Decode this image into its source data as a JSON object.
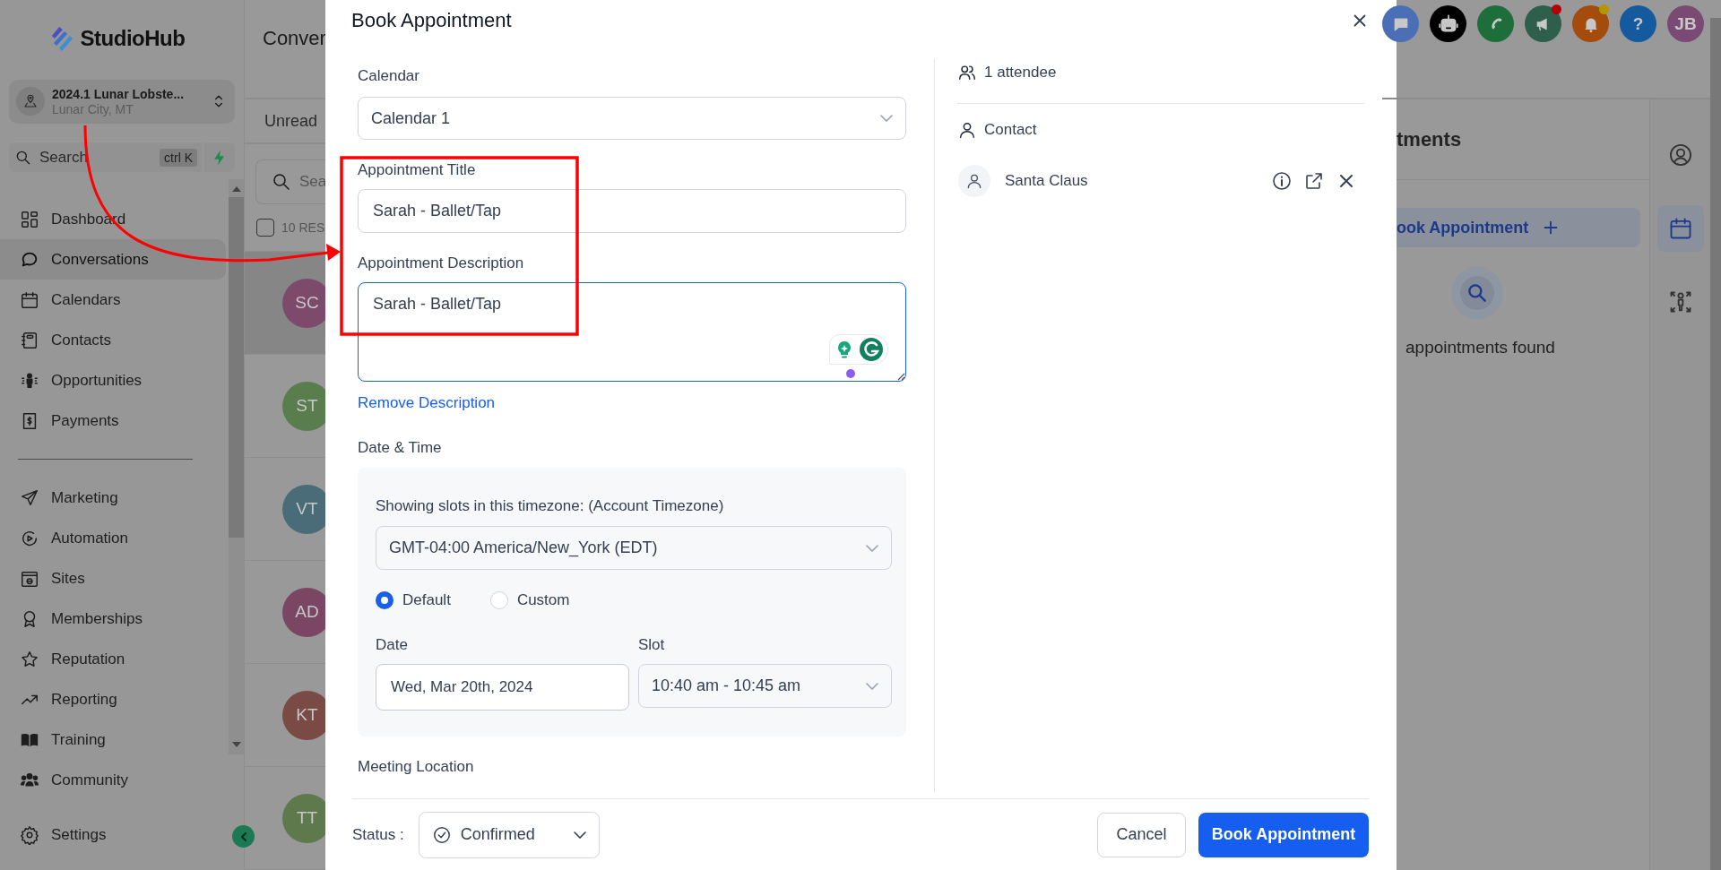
{
  "sidebar": {
    "logo": "StudioHub",
    "location": {
      "name": "2024.1 Lunar Lobste...",
      "city": "Lunar City, MT"
    },
    "search": {
      "placeholder": "Search",
      "shortcut": "ctrl K"
    },
    "nav": [
      {
        "label": "Dashboard",
        "selected": false
      },
      {
        "label": "Conversations",
        "selected": true
      },
      {
        "label": "Calendars",
        "selected": false
      },
      {
        "label": "Contacts",
        "selected": false
      },
      {
        "label": "Opportunities",
        "selected": false
      },
      {
        "label": "Payments",
        "selected": false
      }
    ],
    "nav_secondary": [
      {
        "label": "Marketing",
        "selected": false
      },
      {
        "label": "Automation",
        "selected": false
      },
      {
        "label": "Sites",
        "selected": false
      },
      {
        "label": "Memberships",
        "selected": false
      },
      {
        "label": "Reputation",
        "selected": false
      },
      {
        "label": "Reporting",
        "selected": false
      },
      {
        "label": "Training",
        "selected": false
      },
      {
        "label": "Community",
        "selected": false
      }
    ],
    "settings": {
      "label": "Settings"
    }
  },
  "conversations": {
    "title": "Conver",
    "tab": "Unread",
    "search_placeholder": "Sea",
    "results": "10 RES",
    "select_all": {
      "checked": false
    },
    "rows": [
      {
        "initials": "SC",
        "color": "#7d4a6b",
        "selected": true
      },
      {
        "initials": "ST",
        "color": "#5a7d4e",
        "selected": false
      },
      {
        "initials": "VT",
        "color": "#4a6b78",
        "selected": false
      },
      {
        "initials": "AD",
        "color": "#7a4664",
        "selected": false
      },
      {
        "initials": "KT",
        "color": "#7a4a45",
        "selected": false
      },
      {
        "initials": "TT",
        "color": "#5e7a4c",
        "selected": false
      }
    ]
  },
  "modal": {
    "title": "Book Appointment",
    "calendar": {
      "label": "Calendar",
      "value": "Calendar 1"
    },
    "appointment_title": {
      "label": "Appointment Title",
      "value": "Sarah - Ballet/Tap"
    },
    "description": {
      "label": "Appointment Description",
      "value": "Sarah - Ballet/Tap"
    },
    "remove_description": "Remove Description",
    "date_time": {
      "label": "Date & Time",
      "timezone_label": "Showing slots in this timezone: (Account Timezone)",
      "timezone": "GMT-04:00 America/New_York (EDT)",
      "modes": [
        {
          "label": "Default",
          "selected": true
        },
        {
          "label": "Custom",
          "selected": false
        }
      ],
      "date": {
        "label": "Date",
        "value": "Wed, Mar 20th, 2024"
      },
      "slot": {
        "label": "Slot",
        "value": "10:40 am - 10:45 am"
      }
    },
    "meeting_location": {
      "label": "Meeting Location"
    },
    "attendees": {
      "count": "1 attendee",
      "contact_label": "Contact",
      "contacts": [
        {
          "name": "Santa Claus"
        }
      ]
    },
    "footer": {
      "status_label": "Status :",
      "status": "Confirmed",
      "cancel": "Cancel",
      "submit": "Book Appointment"
    }
  },
  "header_icons": [
    {
      "kind": "chat",
      "color": "#4a6fb5"
    },
    {
      "kind": "robot",
      "color": "#000000"
    },
    {
      "kind": "phone",
      "color": "#1e6e3c"
    },
    {
      "kind": "megaphone",
      "color": "#2e5f4c",
      "dot": {
        "color": "#b50000"
      }
    },
    {
      "kind": "bell",
      "color": "#a34c0c",
      "dot": {
        "color": "#b59500"
      }
    },
    {
      "kind": "help",
      "color": "#155a9e",
      "text": "?"
    },
    {
      "kind": "avatar",
      "color": "#7a4a75",
      "text": "JB"
    }
  ],
  "appointments_panel": {
    "title": "tments",
    "book_button": "ook Appointment",
    "empty": "appointments found"
  },
  "rail": [
    {
      "selected": false
    },
    {
      "selected": true
    },
    {
      "selected": false
    }
  ]
}
